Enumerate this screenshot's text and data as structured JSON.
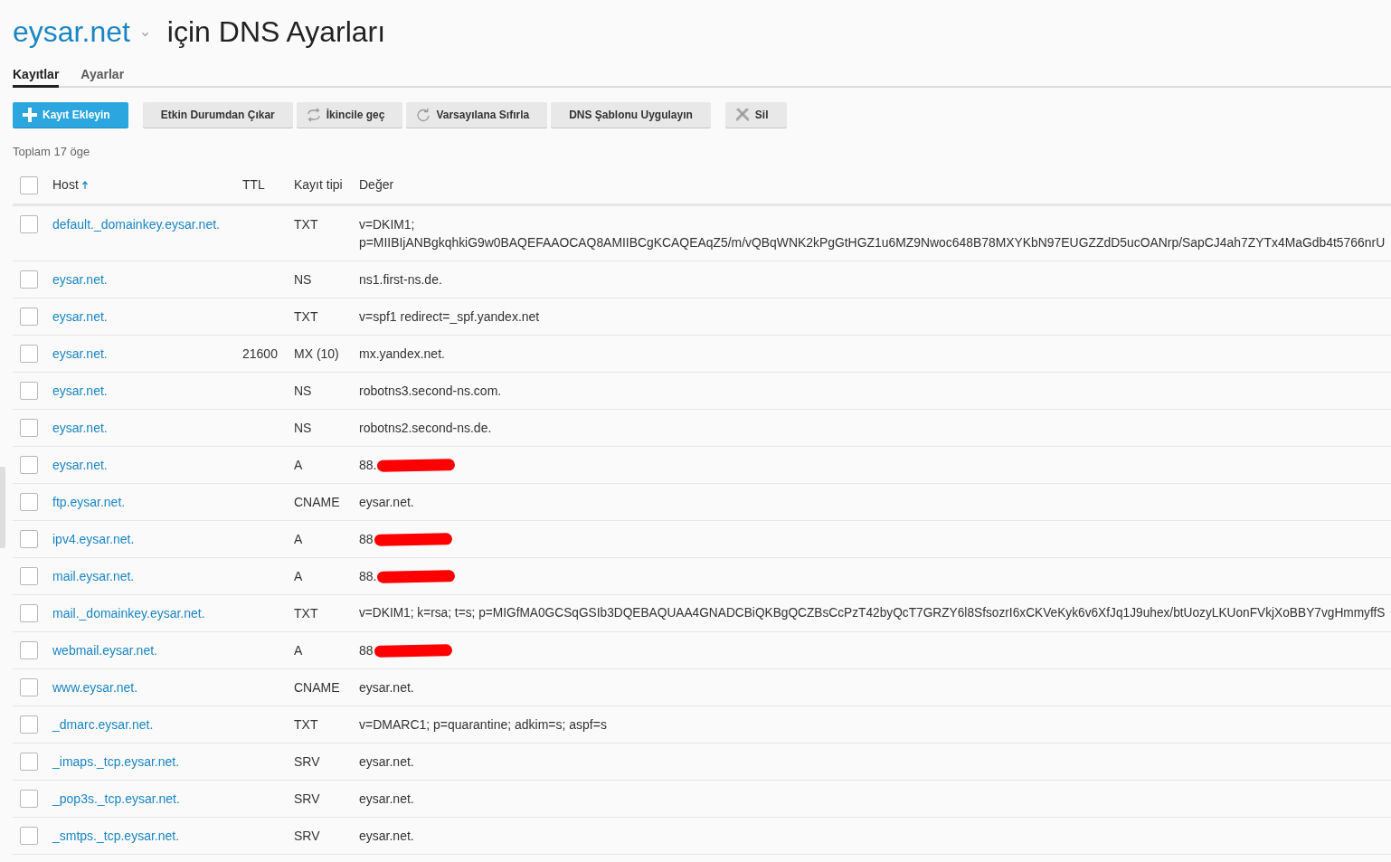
{
  "header": {
    "domain": "eysar.net",
    "title": "için DNS Ayarları"
  },
  "tabs": [
    {
      "label": "Kayıtlar",
      "selected": true
    },
    {
      "label": "Ayarlar",
      "selected": false
    }
  ],
  "toolbar": [
    {
      "label": "Kayıt Ekleyin",
      "kind": "primary"
    },
    {
      "label": "Etkin Durumdan Çıkar",
      "kind": "plain"
    },
    {
      "label": "İkincile geç",
      "kind": "swap"
    },
    {
      "label": "Varsayılana Sıfırla",
      "kind": "reset"
    },
    {
      "label": "DNS Şablonu Uygulayın",
      "kind": "plain"
    },
    {
      "label": "Sil",
      "kind": "delete"
    }
  ],
  "item_count": "Toplam 17 öge",
  "table": {
    "select_all_checked": false,
    "columns": [
      {
        "label": "Host",
        "sorted": true
      },
      {
        "label": "TTL",
        "sorted": false
      },
      {
        "label": "Kayıt tipi",
        "sorted": false
      },
      {
        "label": "Değer",
        "sorted": false
      }
    ],
    "rows": [
      {
        "checked": false,
        "host": "default._domainkey.eysar.net.",
        "type": "TXT",
        "value": "v=DKIM1;\np=MIIBIjANBgkqhkiG9w0BAQEFAAOCAQ8AMIIBCgKCAQEAqZ5/m/vQBqWNK2kPgGtHGZ1u6MZ9Nwoc648B78MXYKbN97EUGZZdD5ucOANrp/SapCJ4ah7ZYTx4MaGdb4t5766nrU",
        "redacted": false
      },
      {
        "checked": false,
        "host": "eysar.net.",
        "type": "NS",
        "value": "ns1.first-ns.de.",
        "redacted": false
      },
      {
        "checked": false,
        "host": "eysar.net.",
        "type": "TXT",
        "value": "v=spf1 redirect=_spf.yandex.net",
        "redacted": false
      },
      {
        "checked": false,
        "host": "eysar.net.",
        "ttl": "21600",
        "type": "MX (10)",
        "value": "mx.yandex.net.",
        "redacted": false
      },
      {
        "checked": false,
        "host": "eysar.net.",
        "type": "NS",
        "value": "robotns3.second-ns.com.",
        "redacted": false
      },
      {
        "checked": false,
        "host": "eysar.net.",
        "type": "NS",
        "value": "robotns2.second-ns.de.",
        "redacted": false
      },
      {
        "checked": false,
        "host": "eysar.net.",
        "type": "A",
        "value": "88.",
        "redacted": true
      },
      {
        "checked": false,
        "host": "ftp.eysar.net.",
        "type": "CNAME",
        "value": "eysar.net.",
        "redacted": false
      },
      {
        "checked": false,
        "host": "ipv4.eysar.net.",
        "type": "A",
        "value": "88",
        "redacted": true
      },
      {
        "checked": false,
        "host": "mail.eysar.net.",
        "type": "A",
        "value": "88.",
        "redacted": true
      },
      {
        "checked": false,
        "host": "mail._domainkey.eysar.net.",
        "type": "TXT",
        "value": "v=DKIM1; k=rsa; t=s; p=MIGfMA0GCSqGSIb3DQEBAQUAA4GNADCBiQKBgQCZBsCcPzT42byQcT7GRZY6l8SfsozrI6xCKVeKyk6v6XfJq1J9uhex/btUozyLKUonFVkjXoBBY7vgHmmyffS",
        "redacted": false
      },
      {
        "checked": false,
        "host": "webmail.eysar.net.",
        "type": "A",
        "value": "88",
        "redacted": true
      },
      {
        "checked": false,
        "host": "www.eysar.net.",
        "type": "CNAME",
        "value": "eysar.net.",
        "redacted": false
      },
      {
        "checked": false,
        "host": "_dmarc.eysar.net.",
        "type": "TXT",
        "value": "v=DMARC1; p=quarantine; adkim=s; aspf=s",
        "redacted": false
      },
      {
        "checked": false,
        "host": "_imaps._tcp.eysar.net.",
        "type": "SRV",
        "value": "eysar.net.",
        "redacted": false
      },
      {
        "checked": false,
        "host": "_pop3s._tcp.eysar.net.",
        "type": "SRV",
        "value": "eysar.net.",
        "redacted": false
      },
      {
        "checked": false,
        "host": "_smtps._tcp.eysar.net.",
        "type": "SRV",
        "value": "eysar.net.",
        "redacted": false
      }
    ]
  }
}
